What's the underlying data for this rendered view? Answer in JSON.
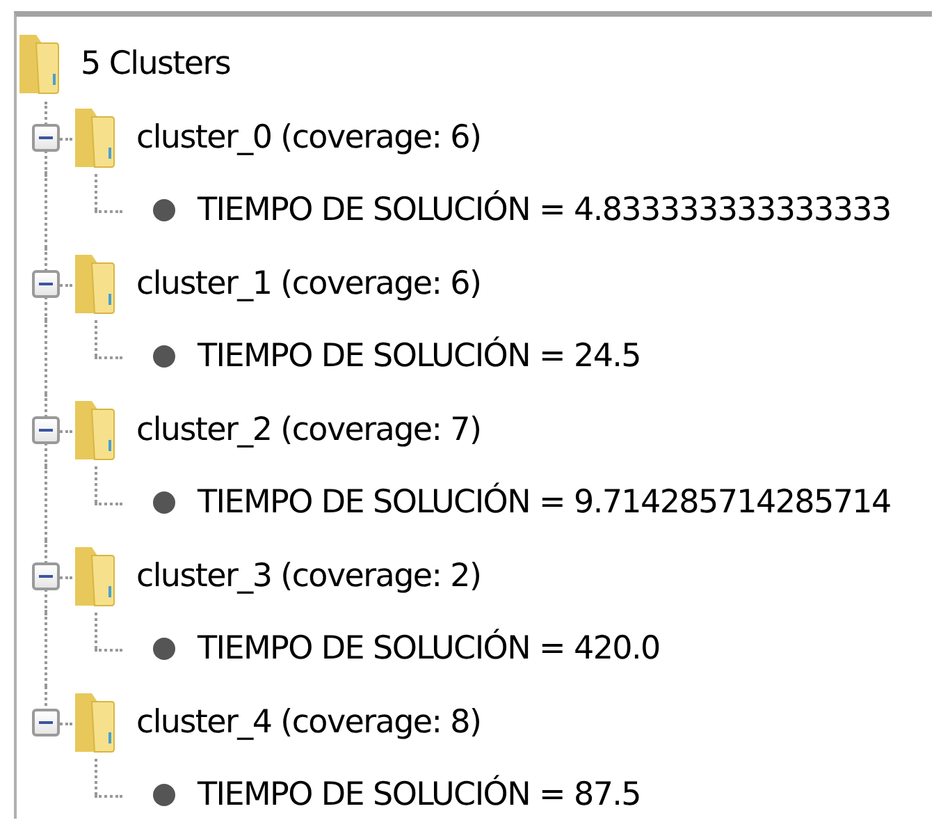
{
  "tree": {
    "label": "5 Clusters",
    "children": [
      {
        "label": "cluster_0 (coverage: 6)",
        "expanded": true,
        "children": [
          {
            "label": "TIEMPO DE SOLUCIÓN = 4.833333333333333"
          }
        ]
      },
      {
        "label": "cluster_1 (coverage: 6)",
        "expanded": true,
        "children": [
          {
            "label": "TIEMPO DE SOLUCIÓN = 24.5"
          }
        ]
      },
      {
        "label": "cluster_2 (coverage: 7)",
        "expanded": true,
        "children": [
          {
            "label": "TIEMPO DE SOLUCIÓN = 9.714285714285714"
          }
        ]
      },
      {
        "label": "cluster_3 (coverage: 2)",
        "expanded": true,
        "children": [
          {
            "label": "TIEMPO DE SOLUCIÓN = 420.0"
          }
        ]
      },
      {
        "label": "cluster_4 (coverage: 8)",
        "expanded": true,
        "children": [
          {
            "label": "TIEMPO DE SOLUCIÓN = 87.5"
          }
        ]
      }
    ]
  }
}
